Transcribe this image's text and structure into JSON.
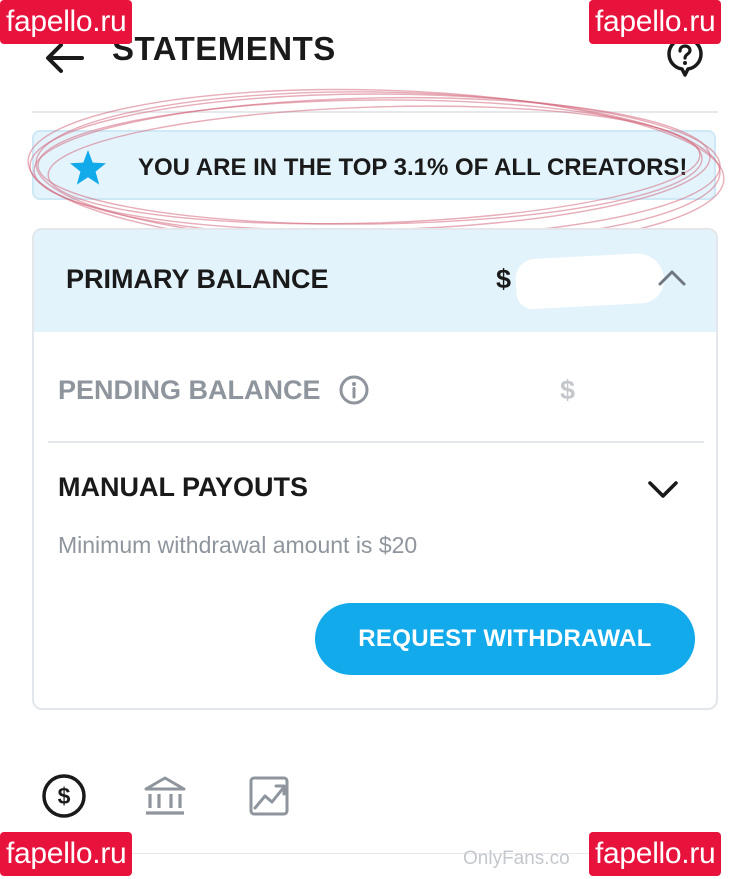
{
  "header": {
    "title": "STATEMENTS",
    "back_icon": "arrow-left-icon",
    "help_icon": "help-bubble-icon"
  },
  "banner": {
    "icon": "star-icon",
    "text": "YOU ARE IN THE TOP 3.1% OF ALL CREATORS!",
    "star_color": "#12aaeb"
  },
  "balance_card": {
    "primary": {
      "label": "PRIMARY BALANCE",
      "amount": "$",
      "icon": "chevron-up-icon"
    },
    "pending": {
      "label": "PENDING BALANCE",
      "icon": "info-icon",
      "amount": "$"
    },
    "payouts": {
      "label": "MANUAL PAYOUTS",
      "icon": "chevron-down-icon",
      "min_text": "Minimum withdrawal amount is $20"
    },
    "withdraw_button": "REQUEST WITHDRAWAL"
  },
  "tabs": [
    {
      "icon": "dollar-circle-icon",
      "active": true
    },
    {
      "icon": "bank-icon",
      "active": false
    },
    {
      "icon": "chart-icon",
      "active": false
    }
  ],
  "watermarks": {
    "corner": "fapello.ru",
    "bottom": "OnlyFans.co"
  },
  "colors": {
    "accent": "#12aaeb",
    "banner_bg": "#e4f4fc",
    "watermark": "#e8133c",
    "muted_text": "#8e959d"
  }
}
